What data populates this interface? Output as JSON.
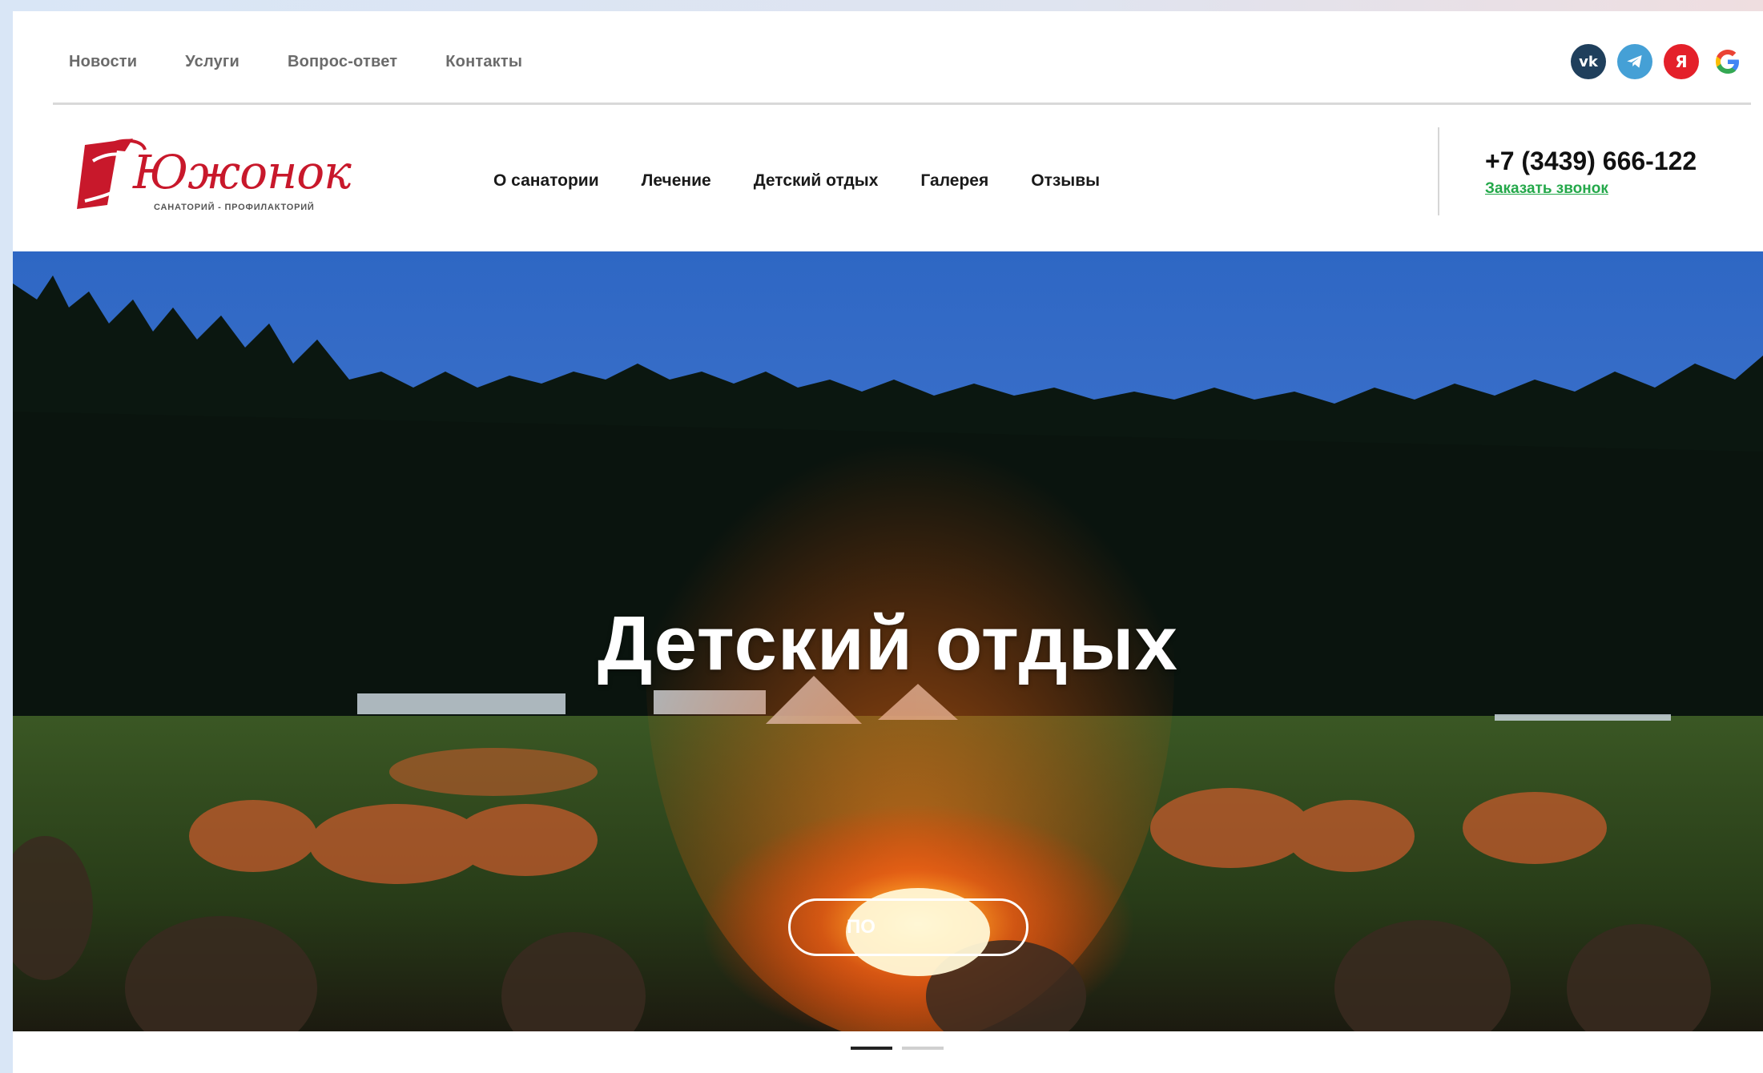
{
  "top_nav": {
    "items": [
      "Новости",
      "Услуги",
      "Вопрос-ответ",
      "Контакты"
    ]
  },
  "social": [
    {
      "name": "vk-icon",
      "glyph": "vk",
      "color": "#1f3f5c"
    },
    {
      "name": "telegram-icon",
      "glyph": "➤",
      "color": "#45a0d6"
    },
    {
      "name": "yandex-icon",
      "glyph": "Я",
      "color": "#e4202a"
    },
    {
      "name": "google-icon",
      "glyph": "G",
      "color": "#ffffff"
    }
  ],
  "logo": {
    "wordmark": "Южонок",
    "subtitle": "САНАТОРИЙ - ПРОФИЛАКТОРИЙ"
  },
  "main_nav": {
    "items": [
      "О санатории",
      "Лечение",
      "Детский отдых",
      "Галерея",
      "Отзывы"
    ]
  },
  "contact": {
    "phone": "+7 (3439) 666-122",
    "callback": "Заказать звонок"
  },
  "hero": {
    "title": "Детский отдых",
    "button_label": "По"
  },
  "slider": {
    "count": 2,
    "active_index": 0
  },
  "colors": {
    "brand_red": "#c8182b",
    "link_green": "#24a84a"
  }
}
